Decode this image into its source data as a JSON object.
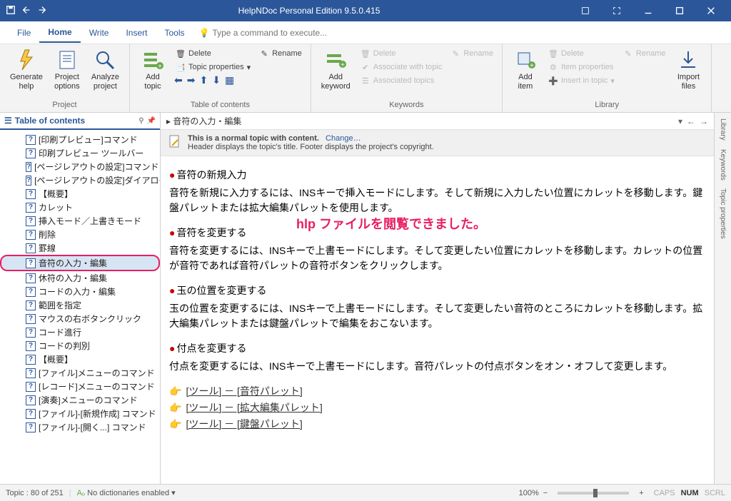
{
  "titlebar": {
    "title": "HelpNDoc Personal Edition 9.5.0.415"
  },
  "menu": {
    "file": "File",
    "home": "Home",
    "write": "Write",
    "insert": "Insert",
    "tools": "Tools",
    "tellme_placeholder": "Type a command to execute..."
  },
  "ribbon": {
    "project": {
      "generate_help": "Generate\nhelp",
      "project_options": "Project\noptions",
      "analyze_project": "Analyze\nproject",
      "group_label": "Project"
    },
    "toc": {
      "add_topic": "Add\ntopic",
      "delete": "Delete",
      "rename": "Rename",
      "topic_properties": "Topic properties",
      "group_label": "Table of contents"
    },
    "keywords": {
      "add_keyword": "Add\nkeyword",
      "delete": "Delete",
      "rename": "Rename",
      "associate": "Associate with topic",
      "associated": "Associated topics",
      "group_label": "Keywords"
    },
    "library": {
      "add_item": "Add\nitem",
      "delete": "Delete",
      "rename": "Rename",
      "item_props": "Item properties",
      "insert_in_topic": "Insert in topic",
      "import_files": "Import\nfiles",
      "group_label": "Library"
    }
  },
  "side": {
    "header": "Table of contents",
    "items": [
      "[印刷プレビュー]コマンド",
      "印刷プレビュー ツールバー",
      "[ページレアウトの設定]コマンド",
      "[ページレアウトの設定]ダイアログ",
      "【概要】",
      "カレット",
      "挿入モード／上書きモード",
      "削除",
      "罫線",
      "音符の入力・編集",
      "休符の入力・編集",
      "コードの入力・編集",
      "範囲を指定",
      "マウスの右ボタンクリック",
      "コード進行",
      "コードの判別",
      "【概要】",
      "[ファイル]メニューのコマンド",
      "[レコード]メニューのコマンド",
      "[演奏]メニューのコマンド",
      "[ファイル]-[新規作成] コマンド",
      "[ファイル]-[開く...] コマンド"
    ],
    "selected_index": 9
  },
  "breadcrumb": {
    "path": "音符の入力・編集"
  },
  "banner": {
    "line1_bold": "This is a normal topic with content.",
    "line1_link": "Change…",
    "line2": "Header displays the topic's title.   Footer displays the project's copyright."
  },
  "doc": {
    "h1": "音符の新規入力",
    "p1": "音符を新規に入力するには、INSキーで挿入モードにします。そして新規に入力したい位置にカレットを移動します。鍵盤パレットまたは拡大編集パレットを使用します。",
    "overlay": "hlp ファイルを閲覧できました。",
    "h2": "音符を変更する",
    "p2": "音符を変更するには、INSキーで上書モードにします。そして変更したい位置にカレットを移動します。カレットの位置が音符であれば音符パレットの音符ボタンをクリックします。",
    "h3": "玉の位置を変更する",
    "p3": "玉の位置を変更するには、INSキーで上書モードにします。そして変更したい音符のところにカレットを移動します。拡大編集パレットまたは鍵盤パレットで編集をおこないます。",
    "h4": "付点を変更する",
    "p4": "付点を変更するには、INSキーで上書モードにします。音符パレットの付点ボタンをオン・オフして変更します。",
    "link1": "[ツール] － [音符パレット]",
    "link2": "[ツール] － [拡大編集パレット]",
    "link3": "[ツール] － [鍵盤パレット]"
  },
  "rail": {
    "library": "Library",
    "keywords": "Keywords",
    "topic_props": "Topic properties"
  },
  "status": {
    "topic_count": "Topic : 80 of 251",
    "dict": "No dictionaries enabled",
    "zoom": "100%",
    "caps": "CAPS",
    "num": "NUM",
    "scrl": "SCRL"
  }
}
